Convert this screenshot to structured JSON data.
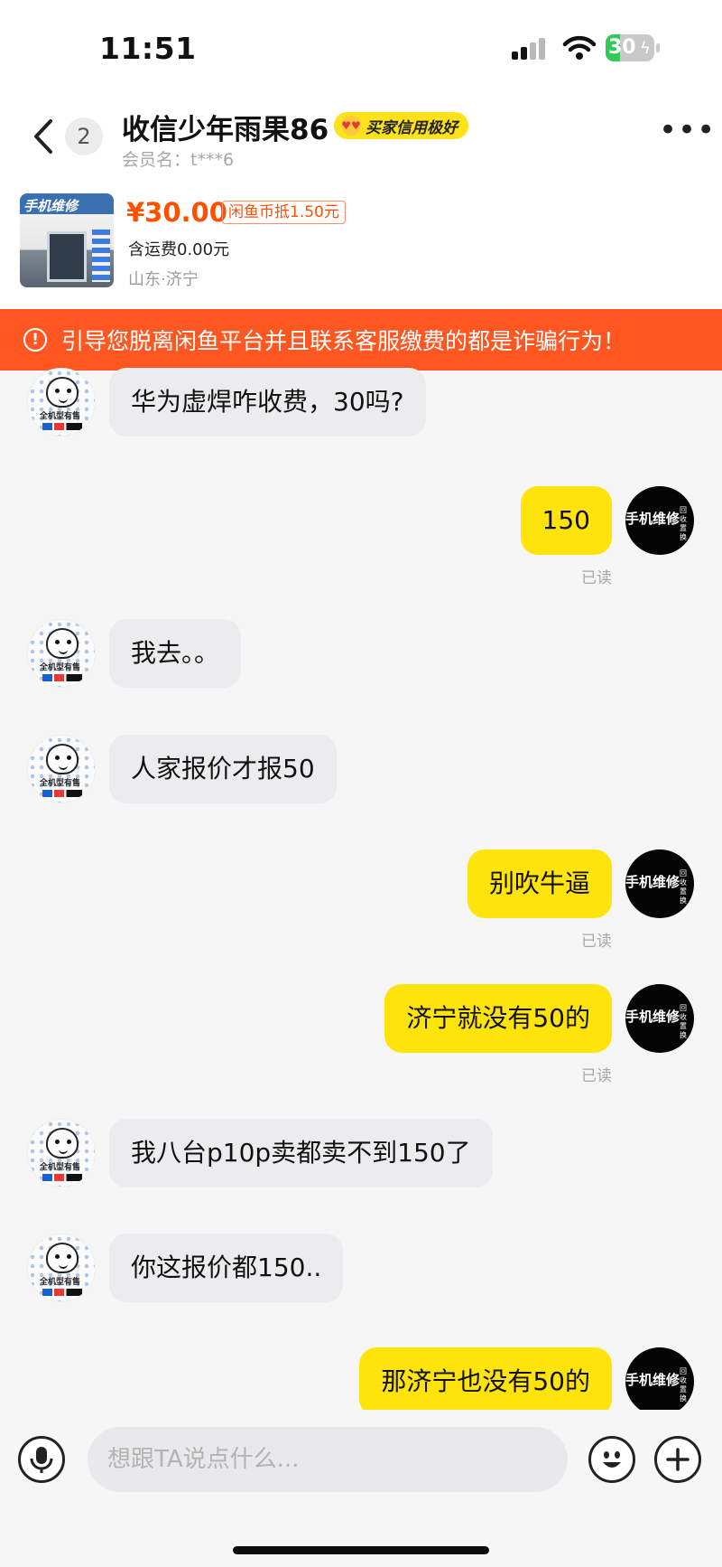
{
  "status_bar": {
    "time": "11:51",
    "battery": "30",
    "battery_level": 0.3,
    "battery_color": "#34c759"
  },
  "header": {
    "unread_count": "2",
    "name": "收信少年雨果86",
    "credit_badge": "买家信用极好",
    "member_label": "会员名：t***6"
  },
  "product": {
    "price": "¥30.00",
    "coin_tag": "闲鱼币抵1.50元",
    "shipping": "含运费0.00元",
    "location": "山东·济宁",
    "thumb_sign": "手机维修"
  },
  "warning": {
    "text": "引导您脱离闲鱼平台并且联系客服缴费的都是诈骗行为！",
    "icon": "alert-circle-icon",
    "color": "#ff5722"
  },
  "avatars": {
    "other_caption": "全机型有售",
    "self_text": "手机维修",
    "self_small": "回收 置换"
  },
  "messages": [
    {
      "side": "left",
      "text": "华为虚焊咋收费，30吗?"
    },
    {
      "side": "right",
      "text": "150",
      "receipt": "已读"
    },
    {
      "side": "left",
      "text": "我去。。"
    },
    {
      "side": "left",
      "text": "人家报价才报50"
    },
    {
      "side": "right",
      "text": "别吹牛逼",
      "receipt": "已读"
    },
    {
      "side": "right",
      "text": "济宁就没有50的",
      "receipt": "已读"
    },
    {
      "side": "left",
      "text": "我八台p10p卖都卖不到150了"
    },
    {
      "side": "left",
      "text": "你这报价都150.."
    },
    {
      "side": "right",
      "text": "那济宁也没有50的"
    }
  ],
  "composer": {
    "placeholder": "想跟TA说点什么...",
    "mic_icon": "microphone-icon",
    "emoji_icon": "emoji-icon",
    "plus_icon": "plus-icon"
  },
  "colors": {
    "accent_yellow": "#ffe40b",
    "price_orange": "#ff5000"
  }
}
